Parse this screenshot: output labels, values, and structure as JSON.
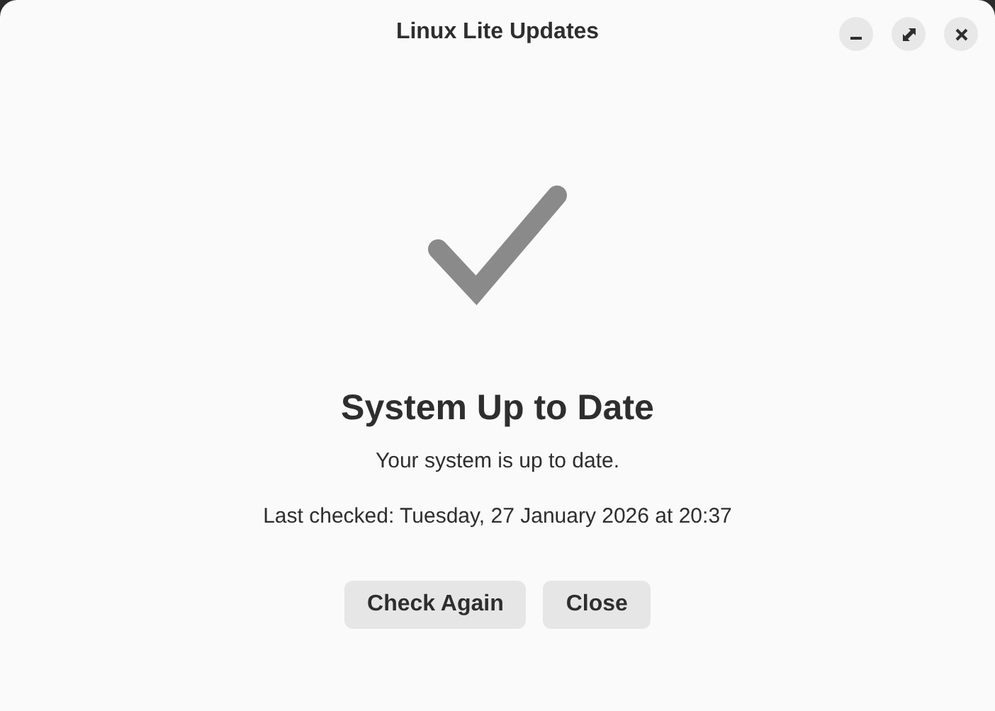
{
  "window": {
    "title": "Linux Lite Updates"
  },
  "status": {
    "heading": "System Up to Date",
    "message": "Your system is up to date.",
    "last_checked": "Last checked: Tuesday, 27 January 2026 at 20:37"
  },
  "buttons": [
    {
      "label": "Check Again"
    },
    {
      "label": "Close"
    }
  ]
}
